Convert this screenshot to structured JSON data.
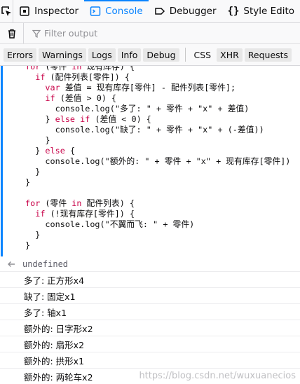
{
  "tabs": [
    {
      "label": "Inspector",
      "icon": "inspector-icon"
    },
    {
      "label": "Console",
      "icon": "console-icon"
    },
    {
      "label": "Debugger",
      "icon": "debugger-icon"
    },
    {
      "label": "Style Edito",
      "icon": "style-editor-icon"
    }
  ],
  "toolbar": {
    "filter_placeholder": "Filter output"
  },
  "filter_buttons": [
    "Errors",
    "Warnings",
    "Logs",
    "Info",
    "Debug"
  ],
  "net_buttons": [
    "CSS",
    "XHR",
    "Requests"
  ],
  "code_lines": [
    "for (零件 in 现有库存) {",
    "  if (配件列表[零件]) {",
    "    var 差值 = 现有库存[零件] - 配件列表[零件];",
    "    if (差值 > 0) {",
    "      console.log(\"多了: \" + 零件 + \"x\" + 差值)",
    "    } else if (差值 < 0) {",
    "      console.log(\"缺了: \" + 零件 + \"x\" + (-差值))",
    "    }",
    "  } else {",
    "    console.log(\"额外的: \" + 零件 + \"x\" + 现有库存[零件])",
    "  }",
    "}",
    "",
    "for (零件 in 配件列表) {",
    "  if (!现有库存[零件]) {",
    "    console.log(\"不翼而飞: \" + 零件)",
    "  }",
    "}"
  ],
  "result": "undefined",
  "logs": [
    "多了: 正方形x4",
    "缺了: 固定x1",
    "多了: 轴x1",
    "额外的: 日字形x2",
    "额外的: 扇形x2",
    "额外的: 拱形x1",
    "额外的: 两轮车x2"
  ],
  "watermark": "https://blog.csdn.net/wuxuanecios",
  "colors": {
    "accent": "#0a84ff",
    "keyword": "#c80047",
    "toolbar_bg": "#f9f9fa"
  }
}
